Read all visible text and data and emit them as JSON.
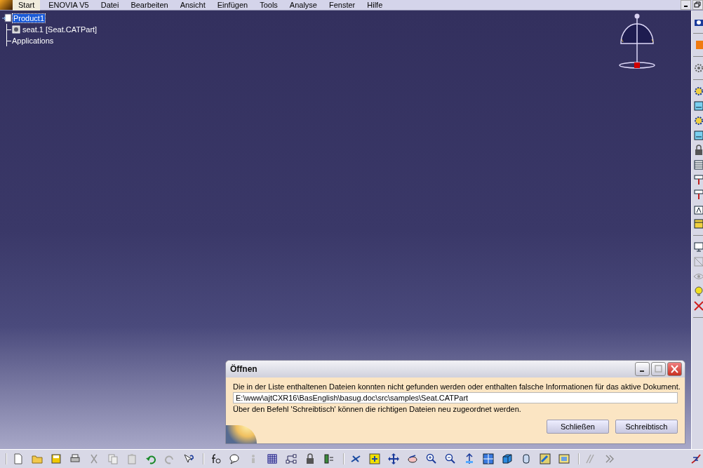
{
  "menu_bar": {
    "items": [
      {
        "label": "Start",
        "selected": true
      },
      {
        "label": "ENOVIA V5",
        "selected": false
      },
      {
        "label": "Datei",
        "selected": false
      },
      {
        "label": "Bearbeiten",
        "selected": false
      },
      {
        "label": "Ansicht",
        "selected": false
      },
      {
        "label": "Einfügen",
        "selected": false
      },
      {
        "label": "Tools",
        "selected": false
      },
      {
        "label": "Analyse",
        "selected": false
      },
      {
        "label": "Fenster",
        "selected": false
      },
      {
        "label": "Hilfe",
        "selected": false
      }
    ]
  },
  "tree": [
    {
      "label": "Product1",
      "selected": true,
      "children": [
        {
          "label": "seat.1 [Seat.CATPart]",
          "selected": false
        },
        {
          "label": "Applications",
          "selected": false
        }
      ]
    }
  ],
  "dialog": {
    "title": "Öffnen",
    "message": "Die in der Liste enthaltenen Dateien konnten nicht gefunden werden oder enthalten falsche Informationen für das aktive Dokument.",
    "path_field": {
      "value": "E:\\www\\ajtCXR16\\BasEnglish\\basug.doc\\src\\samples\\Seat.CATPart"
    },
    "hint": "Über den Befehl 'Schreibtisch' können die richtigen Dateien neu zugeordnet werden.",
    "buttons": [
      "Schließen",
      "Schreibtisch"
    ]
  }
}
